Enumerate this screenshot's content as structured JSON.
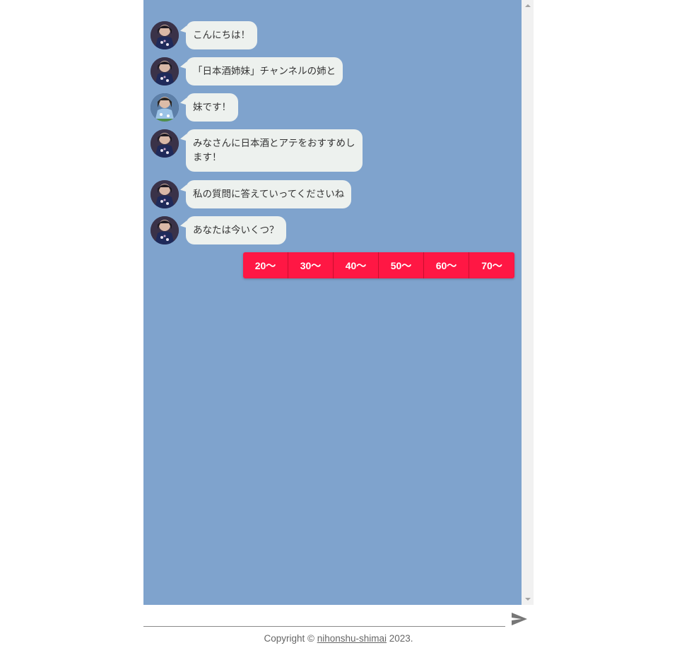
{
  "chat": {
    "messages": [
      {
        "text": "こんにちは！",
        "avatar": "sister-avatar"
      },
      {
        "text": "「日本酒姉妹」チャンネルの姉と",
        "avatar": "sister-avatar"
      },
      {
        "text": "妹です！",
        "avatar": "younger-sister-avatar"
      },
      {
        "text": "みなさんに日本酒とアテをおすすめします！",
        "avatar": "sister-avatar"
      },
      {
        "text": "私の質問に答えていってくださいね",
        "avatar": "sister-avatar"
      },
      {
        "text": "あなたは今いくつ？",
        "avatar": "sister-avatar"
      }
    ],
    "choices": [
      "20〜",
      "30〜",
      "40〜",
      "50〜",
      "60〜",
      "70〜"
    ]
  },
  "input": {
    "value": "",
    "placeholder": ""
  },
  "send": {
    "icon": "send-icon"
  },
  "footer": {
    "prefix": "Copyright © ",
    "link": "nihonshu-shimai",
    "suffix": " 2023."
  },
  "colors": {
    "chat_background": "#7fa3cd",
    "bubble": "#edf1ee",
    "choice_button": "#ff1744"
  }
}
